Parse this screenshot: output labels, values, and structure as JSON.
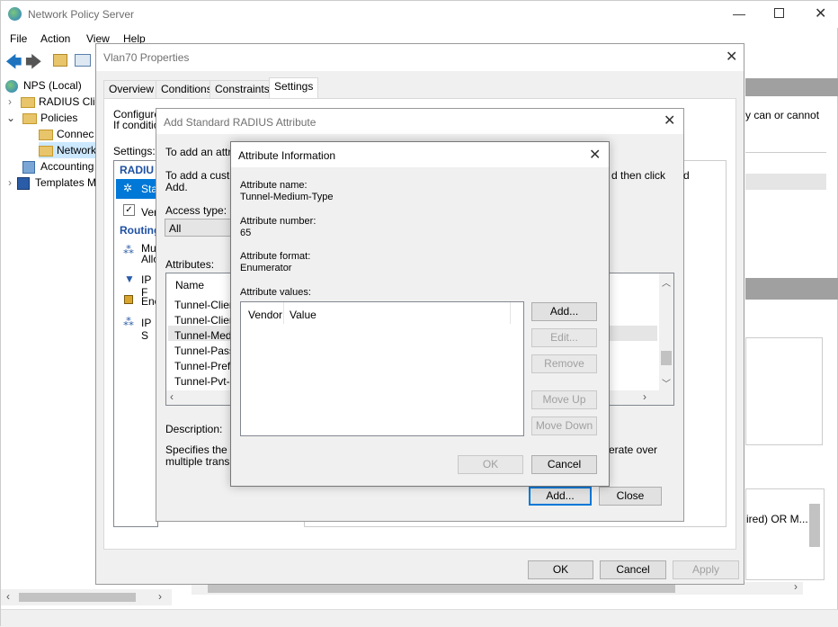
{
  "main_window": {
    "title": "Network Policy Server",
    "menu": [
      "File",
      "Action",
      "View",
      "Help"
    ],
    "tree": {
      "root": "NPS (Local)",
      "radius_clients": "RADIUS Clie",
      "policies": "Policies",
      "connection": "Connec",
      "network": "Network",
      "accounting": "Accounting",
      "templates": "Templates M"
    },
    "right_text": "y can or cannot",
    "right_list_text": "ired) OR M..."
  },
  "properties_dialog": {
    "title": "Vlan70 Properties",
    "tabs": [
      "Overview",
      "Conditions",
      "Constraints",
      "Settings"
    ],
    "active_tab": "Settings",
    "configure_line1": "Configure",
    "configure_line2": "If conditio",
    "settings_label": "Settings:",
    "section_radius": "RADIU",
    "item_standard": "Sta",
    "item_vendor": "Ver",
    "section_routing": "Routing",
    "item_multilink1": "Mu",
    "item_multilink2": "Allo",
    "item_ipfilters": "IP F",
    "item_encryption": "Enc",
    "item_ipsettings": "IP S",
    "ok": "OK",
    "cancel": "Cancel",
    "apply": "Apply"
  },
  "add_std_dialog": {
    "title": "Add Standard RADIUS Attribute",
    "intro1": "To add an attrib",
    "intro2": "To add a custo",
    "intro2_right": "d then click",
    "intro2_right2": "d",
    "intro3": "Add.",
    "access_type_label": "Access type:",
    "access_type_value": "All",
    "attributes_label": "Attributes:",
    "col_name": "Name",
    "rows": [
      "Tunnel-Client-",
      "Tunnel-Client-",
      "Tunnel-Mediu",
      "Tunnel-Passw",
      "Tunnel-Prefer",
      "Tunnel-Pvt-G"
    ],
    "description_label": "Description:",
    "desc1": "Specifies the tra",
    "desc1_right": "erate over",
    "desc2": "multiple transpo",
    "add": "Add...",
    "close": "Close"
  },
  "attr_info_dialog": {
    "title": "Attribute Information",
    "name_label": "Attribute name:",
    "name_value": "Tunnel-Medium-Type",
    "number_label": "Attribute number:",
    "number_value": "65",
    "format_label": "Attribute format:",
    "format_value": "Enumerator",
    "values_label": "Attribute values:",
    "col_vendor": "Vendor",
    "col_value": "Value",
    "add": "Add...",
    "edit": "Edit...",
    "remove": "Remove",
    "move_up": "Move Up",
    "move_down": "Move Down",
    "ok": "OK",
    "cancel": "Cancel"
  }
}
